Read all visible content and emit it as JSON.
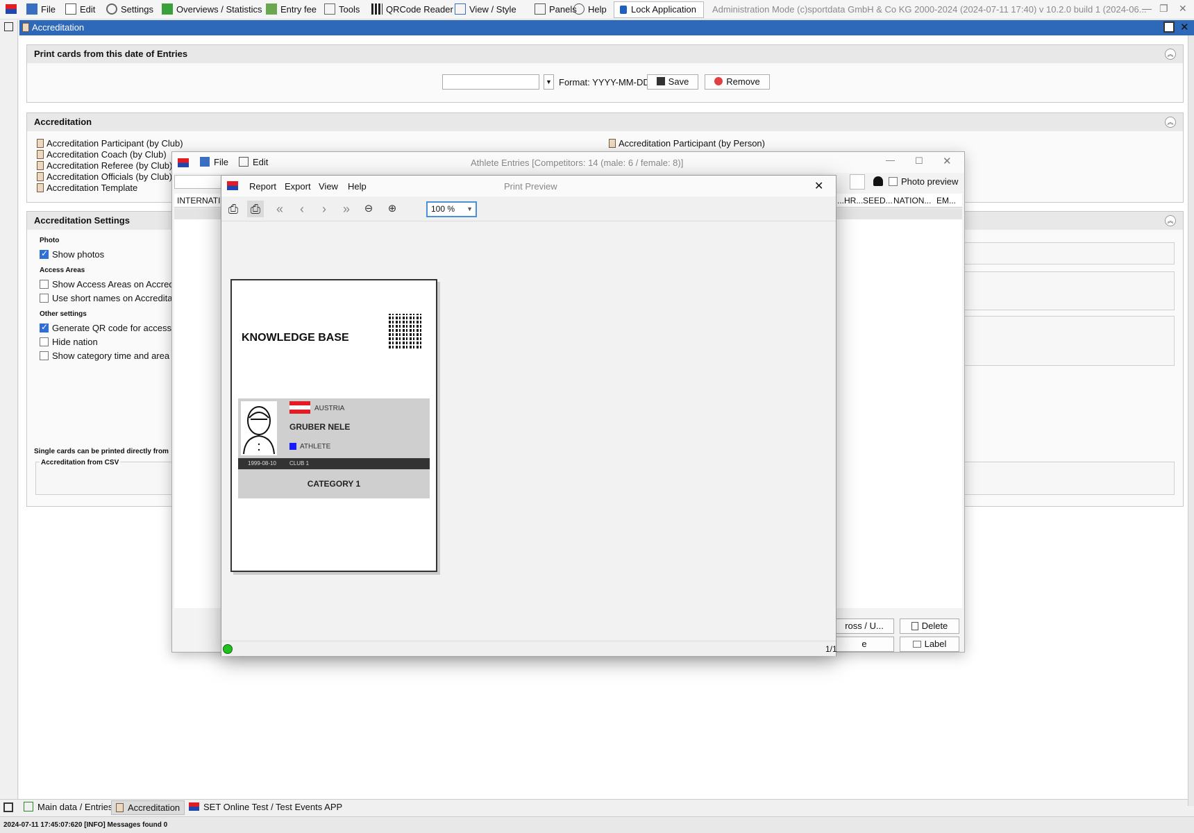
{
  "menubar": {
    "items": [
      "File",
      "Edit",
      "Settings",
      "Overviews / Statistics",
      "Entry fee",
      "Tools",
      "QRCode Reader",
      "View / Style",
      "Panels",
      "Help"
    ],
    "lock_label": "Lock Application",
    "admin_text": "Administration Mode (c)sportdata GmbH & Co KG 2000-2024 (2024-07-11 17:40)  v 10.2.0 build 1 (2024-06..."
  },
  "doc_title": "Accreditation",
  "print_date_panel": {
    "title": "Print cards from this date of Entries",
    "date_value": "",
    "format_label": "Format: YYYY-MM-DD",
    "save_label": "Save",
    "remove_label": "Remove"
  },
  "accreditation_panel": {
    "title": "Accreditation",
    "left_items": [
      "Accreditation Participant (by Club)",
      "Accreditation Coach (by Club)",
      "Accreditation Referee (by Club)",
      "Accreditation Officials (by Club)",
      "Accreditation Template"
    ],
    "right_items": [
      "Accreditation Participant (by Person)"
    ]
  },
  "settings_panel": {
    "title": "Accreditation Settings",
    "photo_group": "Photo",
    "show_photos": "Show photos",
    "access_group": "Access Areas",
    "show_access": "Show Access Areas on Accreditat",
    "short_names": "Use short names on Accreditatio",
    "other_group": "Other settings",
    "gen_qr": "Generate QR code for access con",
    "hide_nation": "Hide nation",
    "show_category": "Show category time and area (if a",
    "single_note": "Single cards can be printed directly from",
    "csv_group": "Accreditation from CSV"
  },
  "athlete_window": {
    "title": "Athlete Entries [Competitors: 14 (male: 6 / female: 8)]",
    "menu": [
      "File",
      "Edit"
    ],
    "photo_preview": "Photo preview",
    "columns_left": "INTERNATIO",
    "columns_right": [
      "...HR...",
      "SEED...",
      "NATION...",
      "EM..."
    ],
    "btn_cross": "ross / U...",
    "btn_delete": "Delete",
    "btn_e": "e",
    "btn_label": "Label"
  },
  "print_preview": {
    "title": "Print Preview",
    "menu": [
      "Report",
      "Export",
      "View",
      "Help"
    ],
    "zoom": "100 %",
    "page_counter": "1/1"
  },
  "card": {
    "org": "KNOWLEDGE BASE",
    "country": "AUSTRIA",
    "name": "GRUBER NELE",
    "role": "ATHLETE",
    "dob": "1999-08-10",
    "club": "CLUB 1",
    "category": "CATEGORY 1",
    "role_color": "#1a1aff"
  },
  "bottom_tabs": [
    "Main data / Entries",
    "Accreditation",
    "SET Online Test / Test Events APP"
  ],
  "status_text": "2024-07-11 17:45:07:620 [INFO] Messages found 0"
}
